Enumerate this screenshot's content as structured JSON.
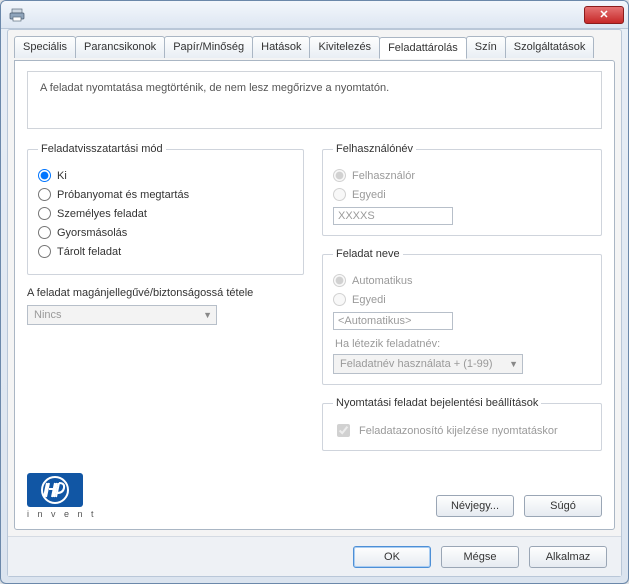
{
  "tabs": {
    "items": [
      "Speciális",
      "Parancsikonok",
      "Papír/Minőség",
      "Hatások",
      "Kivitelezés",
      "Feladattárolás",
      "Szín",
      "Szolgáltatások"
    ],
    "active_index": 5
  },
  "info_text": "A feladat nyomtatása megtörténik, de nem lesz megőrizve a nyomtatón.",
  "retention": {
    "legend": "Feladatvisszatartási mód",
    "options": {
      "off": "Ki",
      "proof": "Próbanyomat és megtartás",
      "personal": "Személyes feladat",
      "quickcopy": "Gyorsmásolás",
      "stored": "Tárolt feladat"
    },
    "selected": "off"
  },
  "privacy": {
    "label": "A feladat magánjellegűvé/biztonságossá tétele",
    "value": "Nincs"
  },
  "username": {
    "legend": "Felhasználónév",
    "user_option": "Felhasználór",
    "custom_option": "Egyedi",
    "value": "XXXXS"
  },
  "jobname": {
    "legend": "Feladat neve",
    "auto_option": "Automatikus",
    "custom_option": "Egyedi",
    "value": "<Automatikus>",
    "exists_label": "Ha létezik feladatnév:",
    "exists_value": "Feladatnév használata + (1-99)"
  },
  "notify": {
    "legend": "Nyomtatási feladat bejelentési beállítások",
    "checkbox_label": "Feladatazonosító kijelzése nyomtatáskor"
  },
  "logo_invent": "i n v e n t",
  "buttons": {
    "about": "Névjegy...",
    "help": "Súgó",
    "ok": "OK",
    "cancel": "Mégse",
    "apply": "Alkalmaz"
  }
}
